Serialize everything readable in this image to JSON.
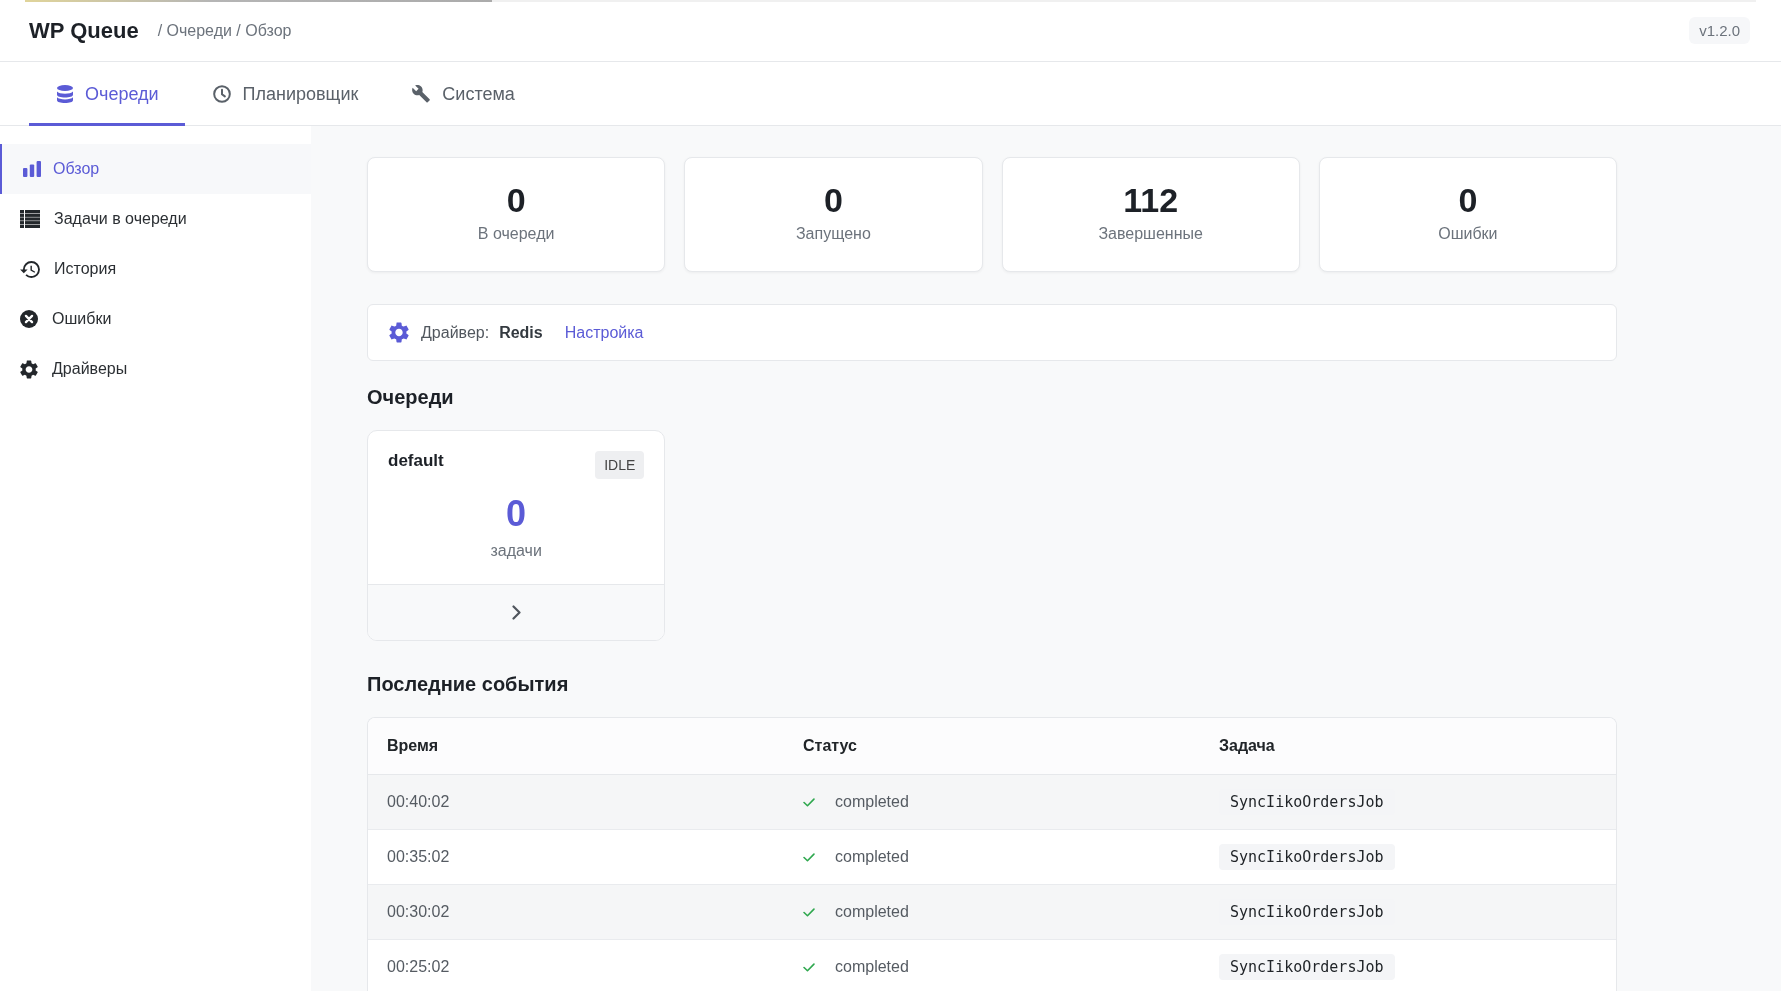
{
  "loading_bar": {
    "level": 0.27
  },
  "header": {
    "title": "WP Queue",
    "breadcrumb": "/ Очереди / Обзор",
    "version": "v1.2.0"
  },
  "tabs": [
    {
      "label": "Очереди",
      "selected": true
    },
    {
      "label": "Планировщик",
      "selected": false
    },
    {
      "label": "Система",
      "selected": false
    }
  ],
  "sidebar": {
    "items": [
      {
        "label": "Обзор",
        "selected": true
      },
      {
        "label": "Задачи в очереди",
        "selected": false
      },
      {
        "label": "История",
        "selected": false
      },
      {
        "label": "Ошибки",
        "selected": false
      },
      {
        "label": "Драйверы",
        "selected": false
      }
    ]
  },
  "stats": [
    {
      "value": "0",
      "label": "В очереди"
    },
    {
      "value": "0",
      "label": "Запущено"
    },
    {
      "value": "112",
      "label": "Завершенные"
    },
    {
      "value": "0",
      "label": "Ошибки"
    }
  ],
  "driver": {
    "label": "Драйвер:",
    "name": "Redis",
    "link": "Настройка"
  },
  "queues": {
    "title": "Очереди",
    "items": [
      {
        "name": "default",
        "status": "IDLE",
        "count": "0",
        "count_label": "задачи"
      }
    ]
  },
  "events": {
    "title": "Последние события",
    "columns": [
      "Время",
      "Статус",
      "Задача"
    ],
    "rows": [
      {
        "time": "00:40:02",
        "status": "completed",
        "job": "SyncIikoOrdersJob"
      },
      {
        "time": "00:35:02",
        "status": "completed",
        "job": "SyncIikoOrdersJob"
      },
      {
        "time": "00:30:02",
        "status": "completed",
        "job": "SyncIikoOrdersJob"
      },
      {
        "time": "00:25:02",
        "status": "completed",
        "job": "SyncIikoOrdersJob"
      }
    ]
  }
}
